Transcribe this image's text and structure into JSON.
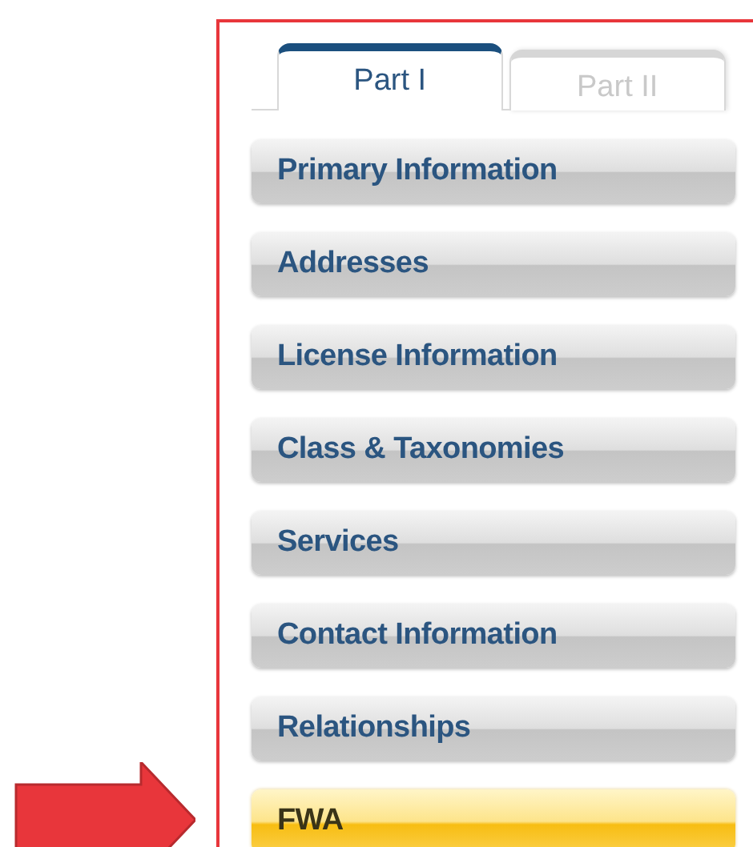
{
  "tabs": [
    {
      "label": "Part I",
      "selected": true
    },
    {
      "label": "Part II",
      "selected": false
    }
  ],
  "items": [
    {
      "label": "Primary Information",
      "selected": false
    },
    {
      "label": "Addresses",
      "selected": false
    },
    {
      "label": "License Information",
      "selected": false
    },
    {
      "label": "Class & Taxonomies",
      "selected": false
    },
    {
      "label": "Services",
      "selected": false
    },
    {
      "label": "Contact Information",
      "selected": false
    },
    {
      "label": "Relationships",
      "selected": false
    },
    {
      "label": "FWA",
      "selected": true
    }
  ]
}
